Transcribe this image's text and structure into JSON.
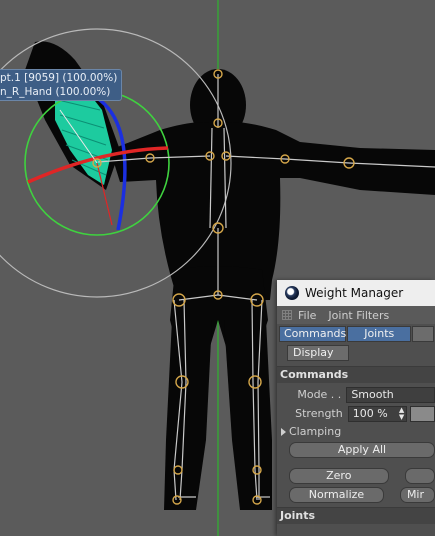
{
  "viewport": {
    "tooltip_line1": "pt.1 [9059] (100.00%)",
    "tooltip_line2": "n_R_Hand (100.00%)"
  },
  "panel": {
    "title": "Weight Manager",
    "menu": [
      "File",
      "Joint Filters"
    ],
    "tabs": [
      "Commands",
      "Joints"
    ],
    "tab_display": "Display",
    "section_commands": "Commands",
    "mode_label": "Mode . .",
    "mode_value": "Smooth",
    "strength_label": "Strength",
    "strength_value": "100 %",
    "clamping_label": "Clamping",
    "apply_all": "Apply All",
    "zero": "Zero",
    "normalize": "Normalize",
    "mirror_partial": "Mir",
    "section_joints": "Joints"
  }
}
